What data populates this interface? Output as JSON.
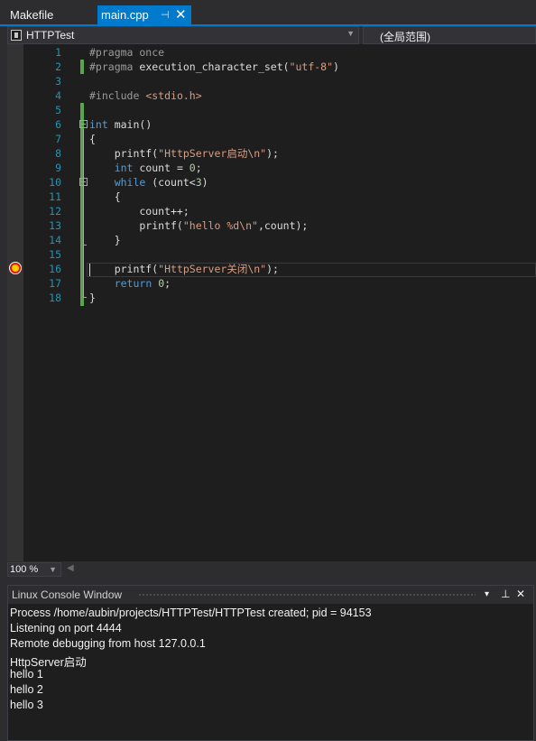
{
  "tabs": [
    {
      "label": "Makefile",
      "active": false
    },
    {
      "label": "main.cpp",
      "active": true
    }
  ],
  "icons": {
    "pin": "pin-icon",
    "close": "close-icon",
    "project": "project-icon",
    "breakpoint": "breakpoint-current-icon"
  },
  "nav": {
    "project": "HTTPTest",
    "scope": "(全局范围)"
  },
  "zoom": "100 %",
  "code_lines": [
    {
      "n": "1",
      "parts": [
        {
          "t": "#pragma once",
          "c": "pp"
        }
      ]
    },
    {
      "n": "2",
      "parts": [
        {
          "t": "#pragma",
          "c": "pp"
        },
        {
          "t": " execution_character_set(",
          "c": ""
        },
        {
          "t": "\"utf-8\"",
          "c": "str"
        },
        {
          "t": ")",
          "c": ""
        }
      ]
    },
    {
      "n": "3",
      "parts": []
    },
    {
      "n": "4",
      "parts": [
        {
          "t": "#include",
          "c": "pp"
        },
        {
          "t": " ",
          "c": ""
        },
        {
          "t": "<stdio.h>",
          "c": "inc"
        }
      ]
    },
    {
      "n": "5",
      "parts": []
    },
    {
      "n": "6",
      "parts": [
        {
          "t": "int",
          "c": "kw"
        },
        {
          "t": " main()",
          "c": ""
        }
      ]
    },
    {
      "n": "7",
      "parts": [
        {
          "t": "{",
          "c": ""
        }
      ]
    },
    {
      "n": "8",
      "parts": [
        {
          "t": "    printf(",
          "c": ""
        },
        {
          "t": "\"HttpServer启动\\n\"",
          "c": "str"
        },
        {
          "t": ");",
          "c": ""
        }
      ]
    },
    {
      "n": "9",
      "parts": [
        {
          "t": "    ",
          "c": ""
        },
        {
          "t": "int",
          "c": "kw"
        },
        {
          "t": " count = ",
          "c": ""
        },
        {
          "t": "0",
          "c": "num"
        },
        {
          "t": ";",
          "c": ""
        }
      ]
    },
    {
      "n": "10",
      "parts": [
        {
          "t": "    ",
          "c": ""
        },
        {
          "t": "while",
          "c": "kw"
        },
        {
          "t": " (count<",
          "c": ""
        },
        {
          "t": "3",
          "c": "num"
        },
        {
          "t": ")",
          "c": ""
        }
      ]
    },
    {
      "n": "11",
      "parts": [
        {
          "t": "    {",
          "c": ""
        }
      ]
    },
    {
      "n": "12",
      "parts": [
        {
          "t": "        count++;",
          "c": ""
        }
      ]
    },
    {
      "n": "13",
      "parts": [
        {
          "t": "        printf(",
          "c": ""
        },
        {
          "t": "\"hello %d\\n\"",
          "c": "str"
        },
        {
          "t": ",count);",
          "c": ""
        }
      ]
    },
    {
      "n": "14",
      "parts": [
        {
          "t": "    }",
          "c": ""
        }
      ]
    },
    {
      "n": "15",
      "parts": []
    },
    {
      "n": "16",
      "parts": [
        {
          "t": "    printf(",
          "c": ""
        },
        {
          "t": "\"HttpServer关闭\\n\"",
          "c": "str"
        },
        {
          "t": ");",
          "c": ""
        }
      ]
    },
    {
      "n": "17",
      "parts": [
        {
          "t": "    ",
          "c": ""
        },
        {
          "t": "return",
          "c": "kw"
        },
        {
          "t": " ",
          "c": ""
        },
        {
          "t": "0",
          "c": "num"
        },
        {
          "t": ";",
          "c": ""
        }
      ]
    },
    {
      "n": "18",
      "parts": [
        {
          "t": "}",
          "c": ""
        }
      ]
    }
  ],
  "console": {
    "title": "Linux Console Window",
    "lines": [
      "Process /home/aubin/projects/HTTPTest/HTTPTest created; pid = 94153",
      "Listening on port 4444",
      "Remote debugging from host 127.0.0.1",
      "HttpServer启动",
      "hello 1",
      "hello 2",
      "hello 3"
    ]
  },
  "panel_buttons": {
    "dropdown": "▾",
    "pin": "📌",
    "close": "✕"
  },
  "colors": {
    "accent": "#007acc",
    "keyword": "#569cd6",
    "string": "#d69d85",
    "line_number": "#2b91af",
    "change_bar": "#57a64a",
    "breakpoint": "#e51400"
  }
}
